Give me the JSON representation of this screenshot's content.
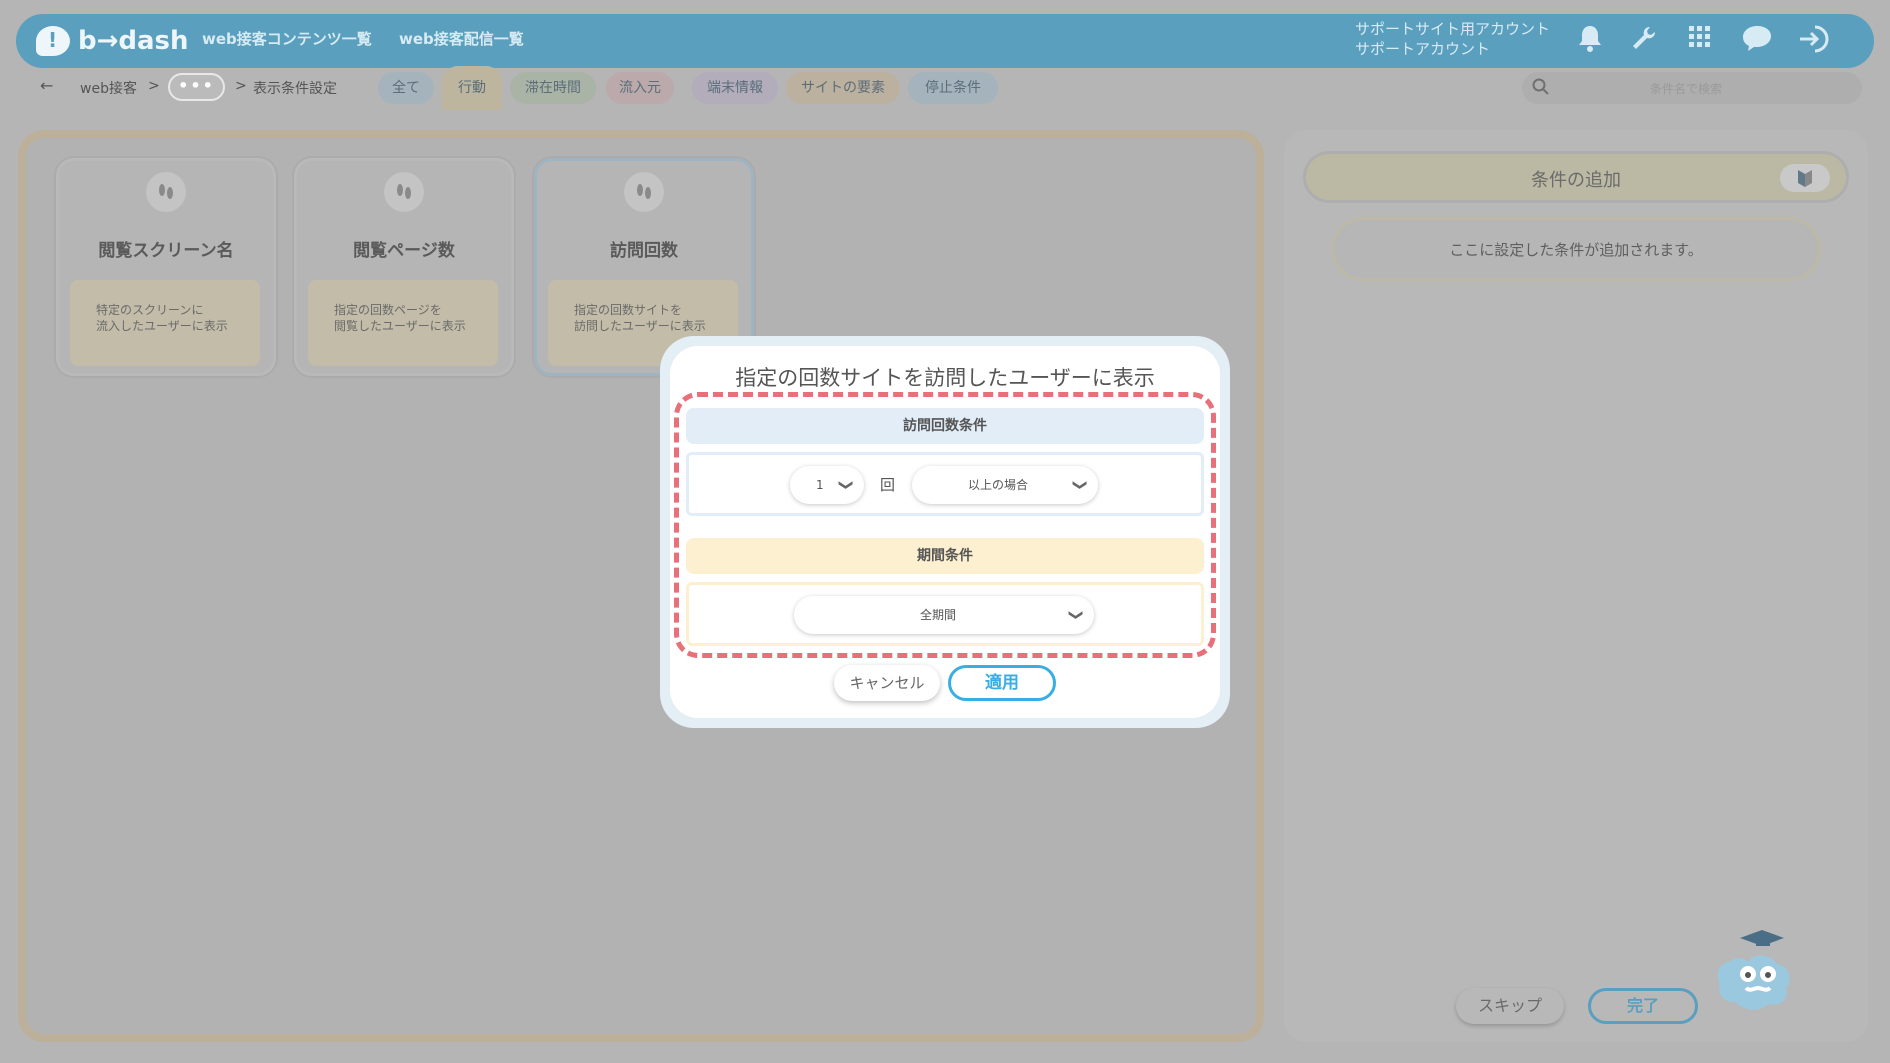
{
  "header": {
    "logo_text": "b→dash",
    "nav": [
      "web接客コンテンツ一覧",
      "web接客配信一覧"
    ],
    "account_line1": "サポートサイト用アカウント",
    "account_line2": "サポートアカウント",
    "icons": [
      "bell-icon",
      "wrench-icon",
      "grid-icon",
      "chat-icon",
      "logout-icon"
    ]
  },
  "breadcrumb": {
    "back_icon": "←",
    "root": "web接客",
    "sep1": ">",
    "ellipsis": "•••",
    "sep2": ">",
    "current": "表示条件設定"
  },
  "filters": [
    "全て",
    "行動",
    "滞在時間",
    "流入元",
    "端末情報",
    "サイトの要素",
    "停止条件"
  ],
  "search": {
    "placeholder": "条件名で検索"
  },
  "cards": [
    {
      "title": "閲覧スクリーン名",
      "desc_line1": "特定のスクリーンに",
      "desc_line2": "流入したユーザーに表示"
    },
    {
      "title": "閲覧ページ数",
      "desc_line1": "指定の回数ページを",
      "desc_line2": "閲覧したユーザーに表示"
    },
    {
      "title": "訪問回数",
      "desc_line1": "指定の回数サイトを",
      "desc_line2": "訪問したユーザーに表示"
    }
  ],
  "right_panel": {
    "title": "条件の追加",
    "placeholder": "ここに設定した条件が追加されます。",
    "skip": "スキップ",
    "done": "完了"
  },
  "modal": {
    "title": "指定の回数サイトを訪問したユーザーに表示",
    "visit_section": "訪問回数条件",
    "count_value": "1",
    "count_unit": "回",
    "comparison": "以上の場合",
    "period_section": "期間条件",
    "period_value": "全期間",
    "cancel": "キャンセル",
    "apply": "適用"
  },
  "colors": {
    "header": "#5a9fbe",
    "visit_section_bg": "#e2edf7",
    "period_section_bg": "#fdf0d0",
    "dashed_border": "#e8707a",
    "apply_accent": "#38aee4"
  }
}
